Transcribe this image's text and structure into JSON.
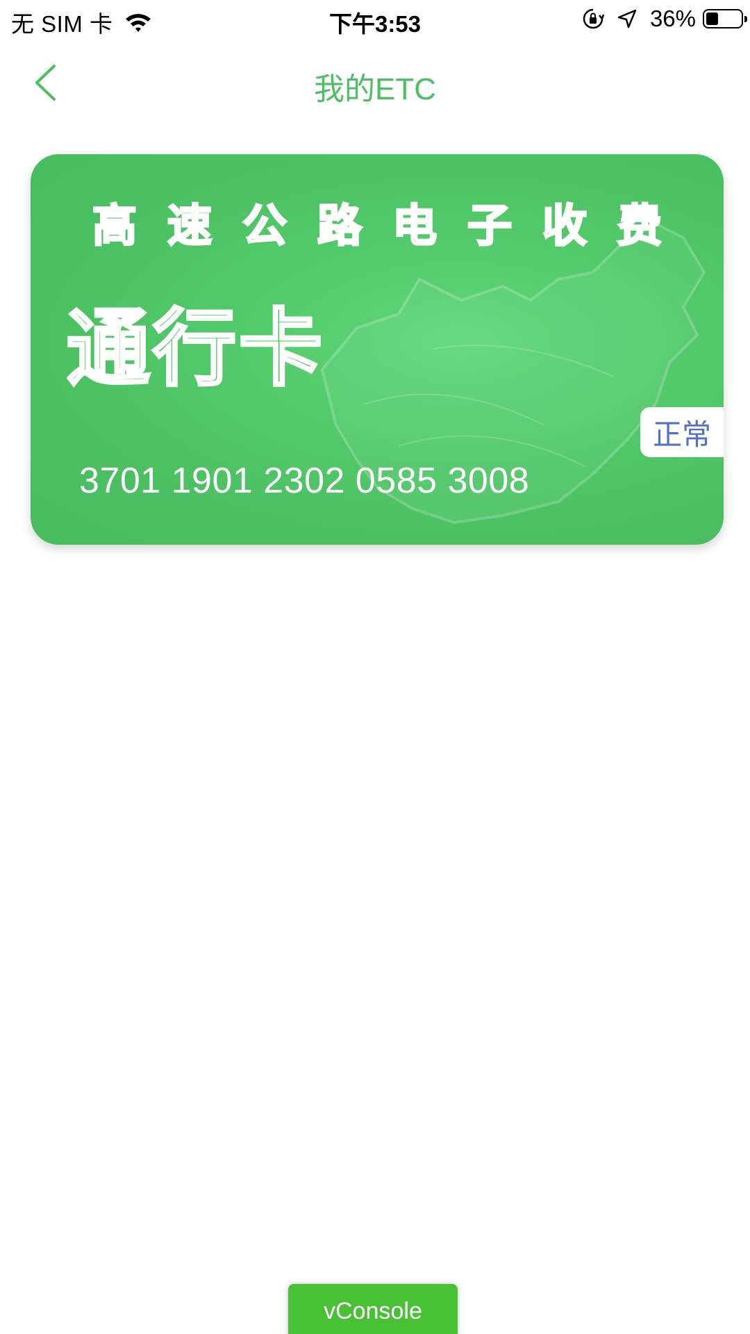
{
  "status_bar": {
    "carrier": "无 SIM 卡",
    "time": "下午3:53",
    "battery_text": "36%",
    "battery_level": 0.36,
    "icons": [
      "wifi-icon",
      "orientation-lock-icon",
      "location-icon",
      "battery-icon"
    ]
  },
  "nav": {
    "title": "我的ETC",
    "back_icon": "chevron-left-icon"
  },
  "card": {
    "heading_chars": [
      "高",
      "速",
      "公",
      "路",
      "电",
      "子",
      "收",
      "费"
    ],
    "type_label": "通行卡",
    "number": "3701 1901 2302 0585 3008",
    "status": "正常"
  },
  "vconsole": {
    "label": "vConsole"
  },
  "colors": {
    "accent": "#4dbf62",
    "card_green": "#4cc463",
    "status_text": "#5470c8",
    "vconsole_green": "#4ac037"
  }
}
